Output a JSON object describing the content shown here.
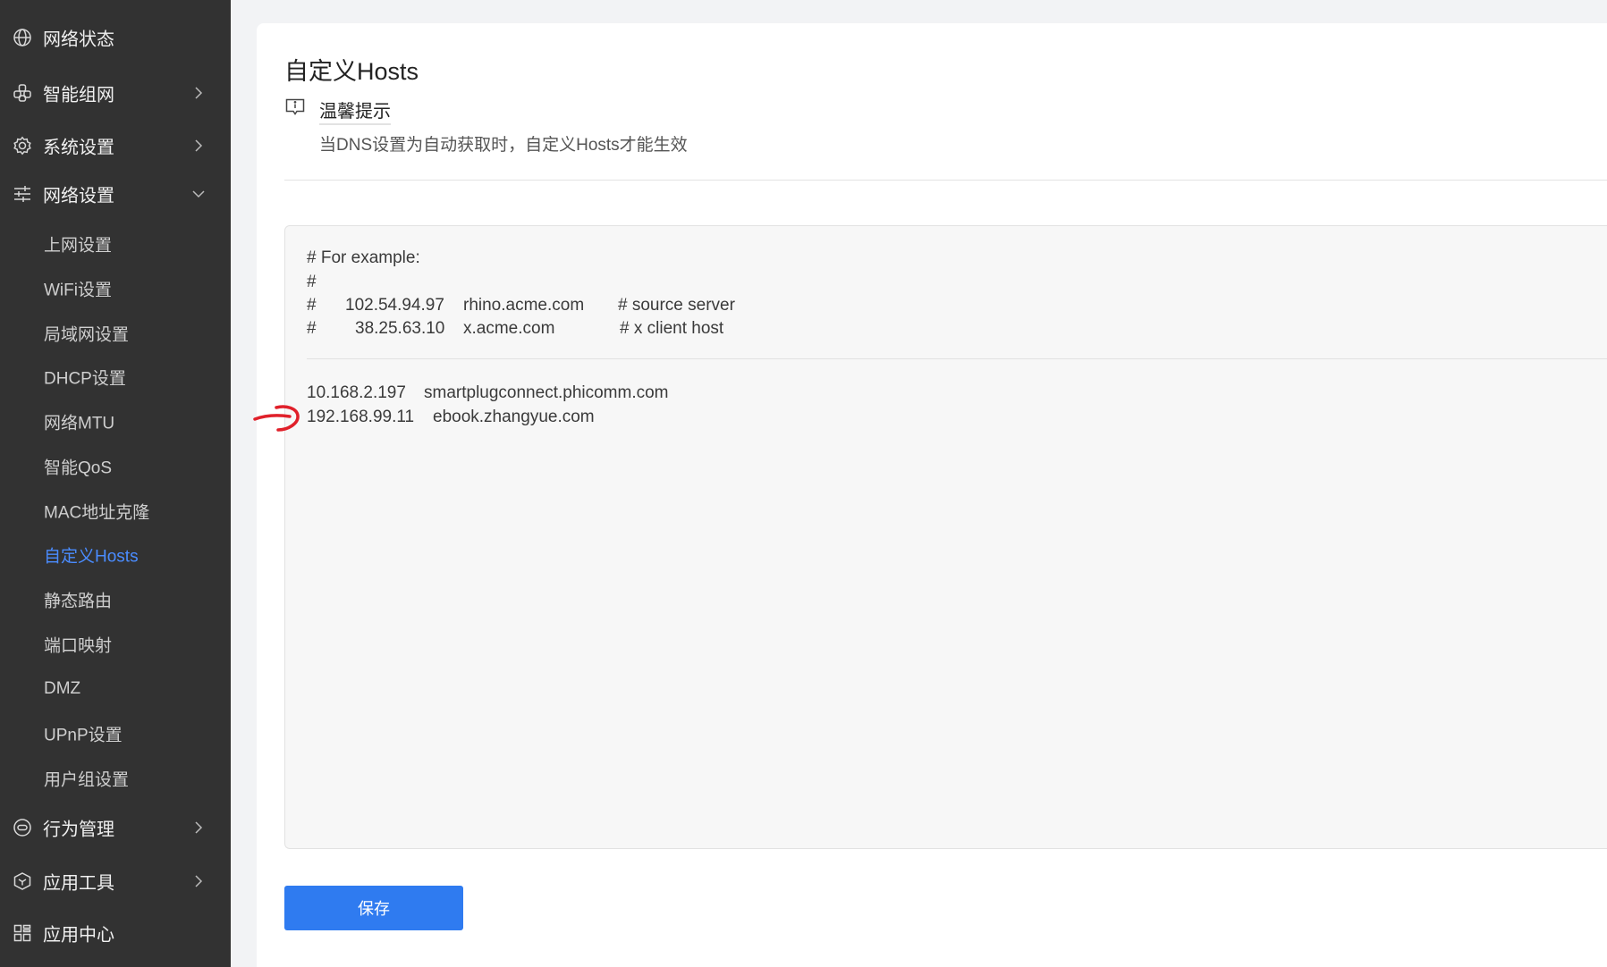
{
  "sidebar": {
    "top_items": [
      {
        "label": "网络状态",
        "icon": "globe-icon",
        "has_chevron": false
      },
      {
        "label": "智能组网",
        "icon": "network-icon",
        "has_chevron": true
      },
      {
        "label": "系统设置",
        "icon": "gear-icon",
        "has_chevron": true
      },
      {
        "label": "网络设置",
        "icon": "sliders-icon",
        "has_chevron": true,
        "expanded": true
      }
    ],
    "sub_items": [
      {
        "label": "上网设置"
      },
      {
        "label": "WiFi设置"
      },
      {
        "label": "局域网设置"
      },
      {
        "label": "DHCP设置"
      },
      {
        "label": "网络MTU"
      },
      {
        "label": "智能QoS"
      },
      {
        "label": "MAC地址克隆"
      },
      {
        "label": "自定义Hosts",
        "active": true
      },
      {
        "label": "静态路由"
      },
      {
        "label": "端口映射"
      },
      {
        "label": "DMZ"
      },
      {
        "label": "UPnP设置"
      },
      {
        "label": "用户组设置"
      }
    ],
    "bottom_items": [
      {
        "label": "行为管理",
        "icon": "behavior-icon",
        "has_chevron": true
      },
      {
        "label": "应用工具",
        "icon": "cube-icon",
        "has_chevron": true
      },
      {
        "label": "应用中心",
        "icon": "apps-grid-icon",
        "has_chevron": false
      }
    ]
  },
  "main": {
    "title": "自定义Hosts",
    "tip": {
      "title": "温馨提示",
      "text": "当DNS设置为自动获取时，自定义Hosts才能生效"
    },
    "hosts_example": [
      {
        "c1": "# For example:",
        "c2": "",
        "c3": "",
        "c4": ""
      },
      {
        "c1": "#",
        "c2": "",
        "c3": "",
        "c4": ""
      },
      {
        "c1": "#",
        "c2": "102.54.94.97",
        "c3": "rhino.acme.com",
        "c4": "# source server"
      },
      {
        "c1": "#",
        "c2": "38.25.63.10",
        "c3": "x.acme.com",
        "c4": "# x client host"
      }
    ],
    "hosts_entries": [
      {
        "ip": "10.168.2.197",
        "host": "smartplugconnect.phicomm.com"
      },
      {
        "ip": "192.168.99.11",
        "host": "ebook.zhangyue.com"
      }
    ],
    "save_label": "保存"
  },
  "colors": {
    "sidebar_bg": "#323232",
    "active_accent": "#4a8cff",
    "button_bg": "#2f7bf0",
    "annotation": "#e0202a"
  }
}
